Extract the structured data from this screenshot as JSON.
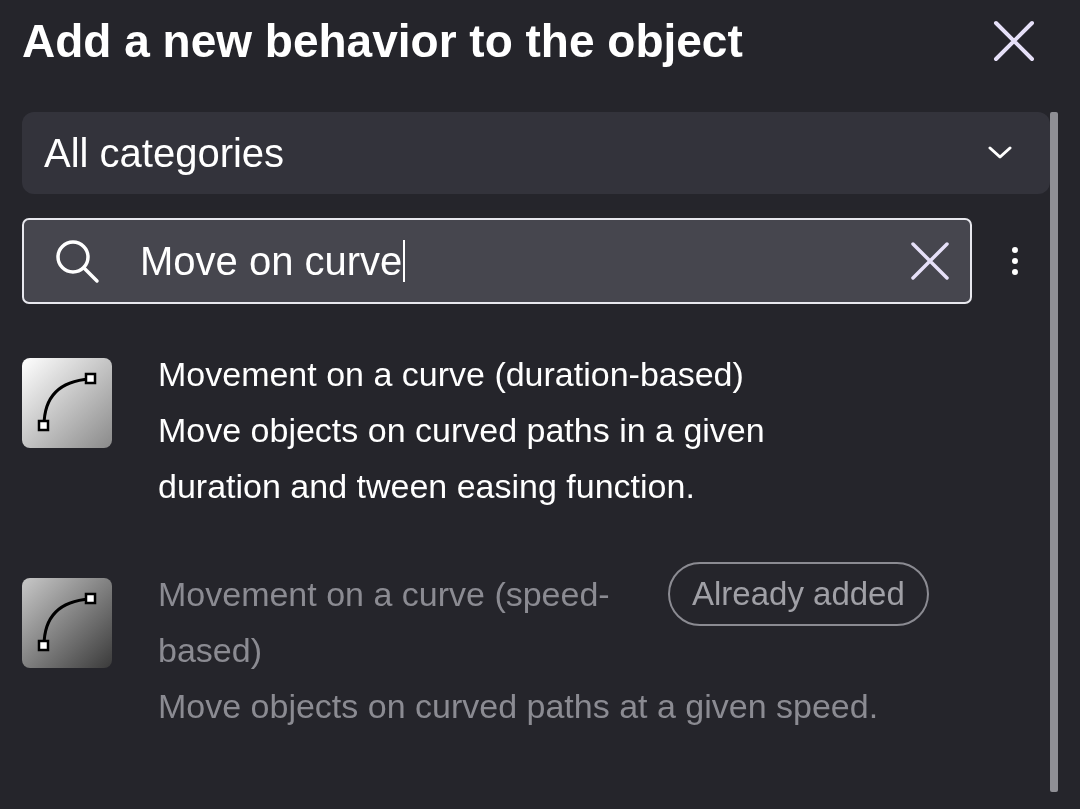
{
  "dialog": {
    "title": "Add a new behavior to the object"
  },
  "category_select": {
    "value": "All categories"
  },
  "search": {
    "value": "Move on curve"
  },
  "behaviors": [
    {
      "name": "Movement on a curve (duration-based)",
      "description": "Move objects on curved paths in a given duration and tween easing function.",
      "disabled": false
    },
    {
      "name": "Movement on a curve (speed-based)",
      "description": "Move objects on curved paths at a given speed.",
      "disabled": true,
      "badge": "Already added"
    }
  ]
}
